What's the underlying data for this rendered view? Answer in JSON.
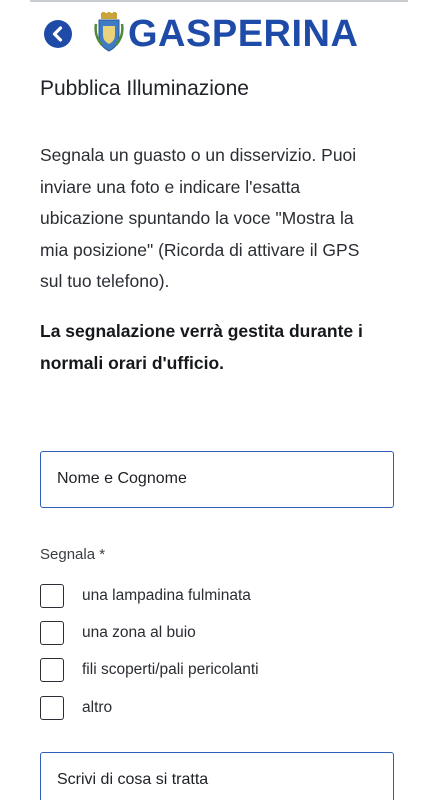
{
  "header": {
    "brand": "GASPERINA",
    "back_icon": "chevron-left-icon",
    "crest_icon": "municipal-crest-icon",
    "brand_color": "#1f4ba8"
  },
  "page": {
    "title": "Pubblica Illuminazione",
    "intro_lines": [
      "Segnala un guasto o un disservizio. Puoi",
      "inviare una foto e indicare l'esatta",
      "ubicazione spuntando la voce \"Mostra la",
      "mia posizione\" (Ricorda di attivare il GPS",
      "sul tuo telefono)."
    ],
    "notice_lines": [
      "La segnalazione verrà gestita durante i",
      "normali orari d'ufficio."
    ]
  },
  "form": {
    "name_placeholder": "Nome e Cognome",
    "report_label": "Segnala *",
    "options": [
      {
        "label": "una lampadina fulminata",
        "checked": false
      },
      {
        "label": "una zona al buio",
        "checked": false
      },
      {
        "label": "fili scoperti/pali pericolanti",
        "checked": false
      },
      {
        "label": "altro",
        "checked": false
      }
    ],
    "description_placeholder": "Scrivi di cosa si tratta",
    "field_border_color": "#2d5fb8"
  }
}
